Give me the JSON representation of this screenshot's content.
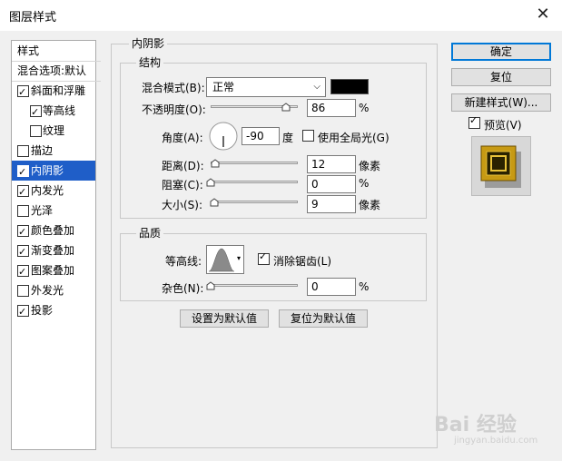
{
  "window": {
    "title": "图层样式"
  },
  "left_panel": {
    "header": "样式",
    "blend_options": "混合选项:默认",
    "items": [
      {
        "label": "斜面和浮雕",
        "checked": true,
        "indent": false,
        "selected": false
      },
      {
        "label": "等高线",
        "checked": true,
        "indent": true,
        "selected": false
      },
      {
        "label": "纹理",
        "checked": false,
        "indent": true,
        "selected": false
      },
      {
        "label": "描边",
        "checked": false,
        "indent": false,
        "selected": false
      },
      {
        "label": "内阴影",
        "checked": true,
        "indent": false,
        "selected": true
      },
      {
        "label": "内发光",
        "checked": true,
        "indent": false,
        "selected": false
      },
      {
        "label": "光泽",
        "checked": false,
        "indent": false,
        "selected": false
      },
      {
        "label": "颜色叠加",
        "checked": true,
        "indent": false,
        "selected": false
      },
      {
        "label": "渐变叠加",
        "checked": true,
        "indent": false,
        "selected": false
      },
      {
        "label": "图案叠加",
        "checked": true,
        "indent": false,
        "selected": false
      },
      {
        "label": "外发光",
        "checked": false,
        "indent": false,
        "selected": false
      },
      {
        "label": "投影",
        "checked": true,
        "indent": false,
        "selected": false
      }
    ]
  },
  "main": {
    "section_title": "内阴影",
    "structure": {
      "title": "结构",
      "blend_mode_label": "混合模式(B):",
      "blend_mode_value": "正常",
      "blend_color": "#000000",
      "opacity_label": "不透明度(O):",
      "opacity_value": "86",
      "opacity_fraction": 0.86,
      "opacity_unit": "%",
      "angle_label": "角度(A):",
      "angle_value": "-90",
      "angle_unit": "度",
      "global_light_label": "使用全局光(G)",
      "global_light_checked": false,
      "distance_label": "距离(D):",
      "distance_value": "12",
      "distance_unit": "像素",
      "distance_fraction": 0.05,
      "choke_label": "阻塞(C):",
      "choke_value": "0",
      "choke_unit": "%",
      "choke_fraction": 0,
      "size_label": "大小(S):",
      "size_value": "9",
      "size_unit": "像素",
      "size_fraction": 0.04
    },
    "quality": {
      "title": "品质",
      "contour_label": "等高线:",
      "antialias_label": "消除锯齿(L)",
      "antialias_checked": true,
      "noise_label": "杂色(N):",
      "noise_value": "0",
      "noise_unit": "%",
      "noise_fraction": 0
    },
    "set_default_button": "设置为默认值",
    "reset_default_button": "复位为默认值"
  },
  "right": {
    "ok_button": "确定",
    "reset_button": "复位",
    "new_style_button": "新建样式(W)...",
    "preview_label": "预览(V)",
    "preview_checked": true
  },
  "watermark": {
    "text": "Bai 经验",
    "sub": "jingyan.baidu.com"
  }
}
